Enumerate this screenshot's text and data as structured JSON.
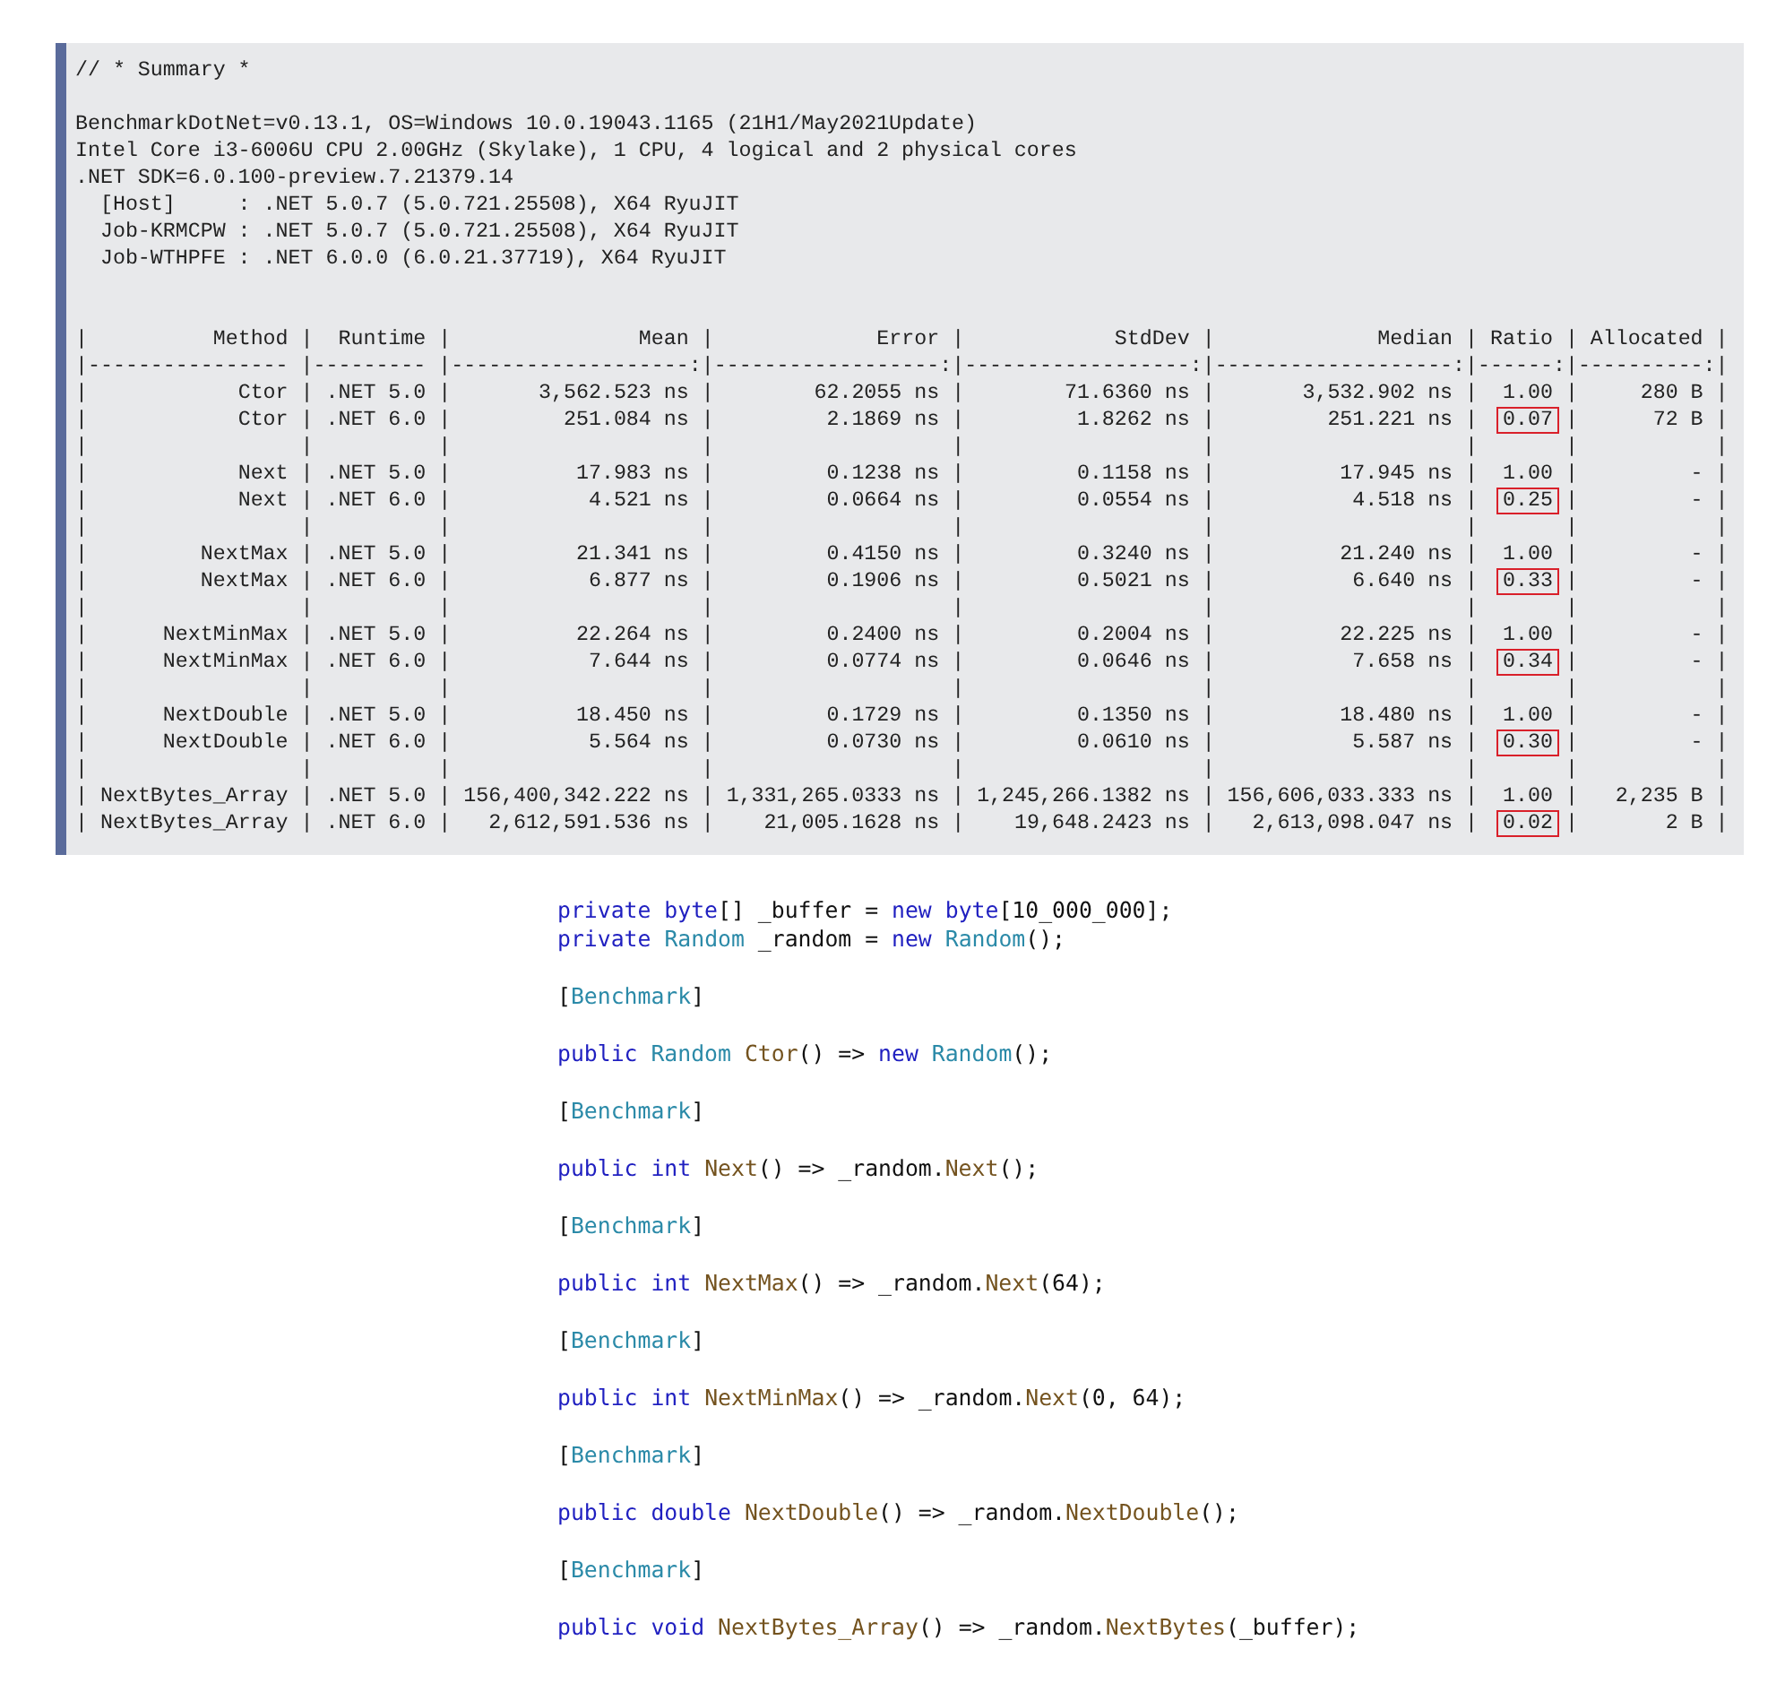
{
  "summary": {
    "blocks": [
      [
        "// * Summary *"
      ],
      [
        "BenchmarkDotNet=v0.13.1, OS=Windows 10.0.19043.1165 (21H1/May2021Update)",
        "Intel Core i3-6006U CPU 2.00GHz (Skylake), 1 CPU, 4 logical and 2 physical cores",
        ".NET SDK=6.0.100-preview.7.21379.14",
        "  [Host]     : .NET 5.0.7 (5.0.721.25508), X64 RyuJIT",
        "  Job-KRMCPW : .NET 5.0.7 (5.0.721.25508), X64 RyuJIT",
        "  Job-WTHPFE : .NET 6.0.0 (6.0.21.37719), X64 RyuJIT"
      ]
    ]
  },
  "table": {
    "separator": "|",
    "columns": [
      "Method",
      "Runtime",
      "Mean",
      "Error",
      "StdDev",
      "Median",
      "Ratio",
      "Allocated"
    ],
    "rule": [
      "---------------- ",
      "--------- ",
      "-------------------:",
      "------------------:",
      "------------------:",
      "-------------------:",
      "------:",
      "----------:"
    ],
    "row_groups": [
      [
        {
          "cells": [
            "Ctor",
            ".NET 5.0",
            "3,562.523 ns",
            "62.2055 ns",
            "71.6360 ns",
            "3,532.902 ns",
            "1.00",
            "280 B"
          ],
          "boxed": [
            false,
            false,
            false,
            false,
            false,
            false,
            false,
            false
          ]
        },
        {
          "cells": [
            "Ctor",
            ".NET 6.0",
            "251.084 ns",
            "2.1869 ns",
            "1.8262 ns",
            "251.221 ns",
            "0.07",
            "72 B"
          ],
          "boxed": [
            false,
            false,
            false,
            false,
            false,
            false,
            true,
            false
          ]
        }
      ],
      [
        {
          "cells": [
            "Next",
            ".NET 5.0",
            "17.983 ns",
            "0.1238 ns",
            "0.1158 ns",
            "17.945 ns",
            "1.00",
            "-"
          ],
          "boxed": [
            false,
            false,
            false,
            false,
            false,
            false,
            false,
            false
          ]
        },
        {
          "cells": [
            "Next",
            ".NET 6.0",
            "4.521 ns",
            "0.0664 ns",
            "0.0554 ns",
            "4.518 ns",
            "0.25",
            "-"
          ],
          "boxed": [
            false,
            false,
            false,
            false,
            false,
            false,
            true,
            false
          ]
        }
      ],
      [
        {
          "cells": [
            "NextMax",
            ".NET 5.0",
            "21.341 ns",
            "0.4150 ns",
            "0.3240 ns",
            "21.240 ns",
            "1.00",
            "-"
          ],
          "boxed": [
            false,
            false,
            false,
            false,
            false,
            false,
            false,
            false
          ]
        },
        {
          "cells": [
            "NextMax",
            ".NET 6.0",
            "6.877 ns",
            "0.1906 ns",
            "0.5021 ns",
            "6.640 ns",
            "0.33",
            "-"
          ],
          "boxed": [
            false,
            false,
            false,
            false,
            false,
            false,
            true,
            false
          ]
        }
      ],
      [
        {
          "cells": [
            "NextMinMax",
            ".NET 5.0",
            "22.264 ns",
            "0.2400 ns",
            "0.2004 ns",
            "22.225 ns",
            "1.00",
            "-"
          ],
          "boxed": [
            false,
            false,
            false,
            false,
            false,
            false,
            false,
            false
          ]
        },
        {
          "cells": [
            "NextMinMax",
            ".NET 6.0",
            "7.644 ns",
            "0.0774 ns",
            "0.0646 ns",
            "7.658 ns",
            "0.34",
            "-"
          ],
          "boxed": [
            false,
            false,
            false,
            false,
            false,
            false,
            true,
            false
          ]
        }
      ],
      [
        {
          "cells": [
            "NextDouble",
            ".NET 5.0",
            "18.450 ns",
            "0.1729 ns",
            "0.1350 ns",
            "18.480 ns",
            "1.00",
            "-"
          ],
          "boxed": [
            false,
            false,
            false,
            false,
            false,
            false,
            false,
            false
          ]
        },
        {
          "cells": [
            "NextDouble",
            ".NET 6.0",
            "5.564 ns",
            "0.0730 ns",
            "0.0610 ns",
            "5.587 ns",
            "0.30",
            "-"
          ],
          "boxed": [
            false,
            false,
            false,
            false,
            false,
            false,
            true,
            false
          ]
        }
      ],
      [
        {
          "cells": [
            "NextBytes_Array",
            ".NET 5.0",
            "156,400,342.222 ns",
            "1,331,265.0333 ns",
            "1,245,266.1382 ns",
            "156,606,033.333 ns",
            "1.00",
            "2,235 B"
          ],
          "boxed": [
            false,
            false,
            false,
            false,
            false,
            false,
            false,
            false
          ]
        },
        {
          "cells": [
            "NextBytes_Array",
            ".NET 6.0",
            "2,612,591.536 ns",
            "21,005.1628 ns",
            "19,648.2423 ns",
            "2,613,098.047 ns",
            "0.02",
            "2 B"
          ],
          "boxed": [
            false,
            false,
            false,
            false,
            false,
            false,
            true,
            false
          ]
        }
      ]
    ]
  },
  "code": {
    "blocks": [
      [
        [
          {
            "text": "private byte",
            "kind": "keyword"
          },
          {
            "text": "[] _buffer = ",
            "kind": "plain"
          },
          {
            "text": "new byte",
            "kind": "keyword"
          },
          {
            "text": "[10_000_000];",
            "kind": "plain"
          }
        ],
        [
          {
            "text": "private ",
            "kind": "keyword"
          },
          {
            "text": "Random",
            "kind": "type"
          },
          {
            "text": " _random = ",
            "kind": "plain"
          },
          {
            "text": "new ",
            "kind": "keyword"
          },
          {
            "text": "Random",
            "kind": "type"
          },
          {
            "text": "();",
            "kind": "plain"
          }
        ]
      ],
      [
        [
          {
            "text": "[",
            "kind": "plain"
          },
          {
            "text": "Benchmark",
            "kind": "type"
          },
          {
            "text": "]",
            "kind": "plain"
          }
        ]
      ],
      [
        [
          {
            "text": "public ",
            "kind": "keyword"
          },
          {
            "text": "Random ",
            "kind": "type"
          },
          {
            "text": "Ctor",
            "kind": "method"
          },
          {
            "text": "() => ",
            "kind": "plain"
          },
          {
            "text": "new ",
            "kind": "keyword"
          },
          {
            "text": "Random",
            "kind": "type"
          },
          {
            "text": "();",
            "kind": "plain"
          }
        ]
      ],
      [
        [
          {
            "text": "[",
            "kind": "plain"
          },
          {
            "text": "Benchmark",
            "kind": "type"
          },
          {
            "text": "]",
            "kind": "plain"
          }
        ]
      ],
      [
        [
          {
            "text": "public int ",
            "kind": "keyword"
          },
          {
            "text": "Next",
            "kind": "method"
          },
          {
            "text": "() => _random.",
            "kind": "plain"
          },
          {
            "text": "Next",
            "kind": "method"
          },
          {
            "text": "();",
            "kind": "plain"
          }
        ]
      ],
      [
        [
          {
            "text": "[",
            "kind": "plain"
          },
          {
            "text": "Benchmark",
            "kind": "type"
          },
          {
            "text": "]",
            "kind": "plain"
          }
        ]
      ],
      [
        [
          {
            "text": "public int ",
            "kind": "keyword"
          },
          {
            "text": "NextMax",
            "kind": "method"
          },
          {
            "text": "() => _random.",
            "kind": "plain"
          },
          {
            "text": "Next",
            "kind": "method"
          },
          {
            "text": "(64);",
            "kind": "plain"
          }
        ]
      ],
      [
        [
          {
            "text": "[",
            "kind": "plain"
          },
          {
            "text": "Benchmark",
            "kind": "type"
          },
          {
            "text": "]",
            "kind": "plain"
          }
        ]
      ],
      [
        [
          {
            "text": "public int ",
            "kind": "keyword"
          },
          {
            "text": "NextMinMax",
            "kind": "method"
          },
          {
            "text": "() => _random.",
            "kind": "plain"
          },
          {
            "text": "Next",
            "kind": "method"
          },
          {
            "text": "(0, 64);",
            "kind": "plain"
          }
        ]
      ],
      [
        [
          {
            "text": "[",
            "kind": "plain"
          },
          {
            "text": "Benchmark",
            "kind": "type"
          },
          {
            "text": "]",
            "kind": "plain"
          }
        ]
      ],
      [
        [
          {
            "text": "public double ",
            "kind": "keyword"
          },
          {
            "text": "NextDouble",
            "kind": "method"
          },
          {
            "text": "() => _random.",
            "kind": "plain"
          },
          {
            "text": "NextDouble",
            "kind": "method"
          },
          {
            "text": "();",
            "kind": "plain"
          }
        ]
      ],
      [
        [
          {
            "text": "[",
            "kind": "plain"
          },
          {
            "text": "Benchmark",
            "kind": "type"
          },
          {
            "text": "]",
            "kind": "plain"
          }
        ]
      ],
      [
        [
          {
            "text": "public void ",
            "kind": "keyword"
          },
          {
            "text": "NextBytes_Array",
            "kind": "method"
          },
          {
            "text": "() => _random.",
            "kind": "plain"
          },
          {
            "text": "NextBytes",
            "kind": "method"
          },
          {
            "text": "(_buffer);",
            "kind": "plain"
          }
        ]
      ]
    ]
  }
}
